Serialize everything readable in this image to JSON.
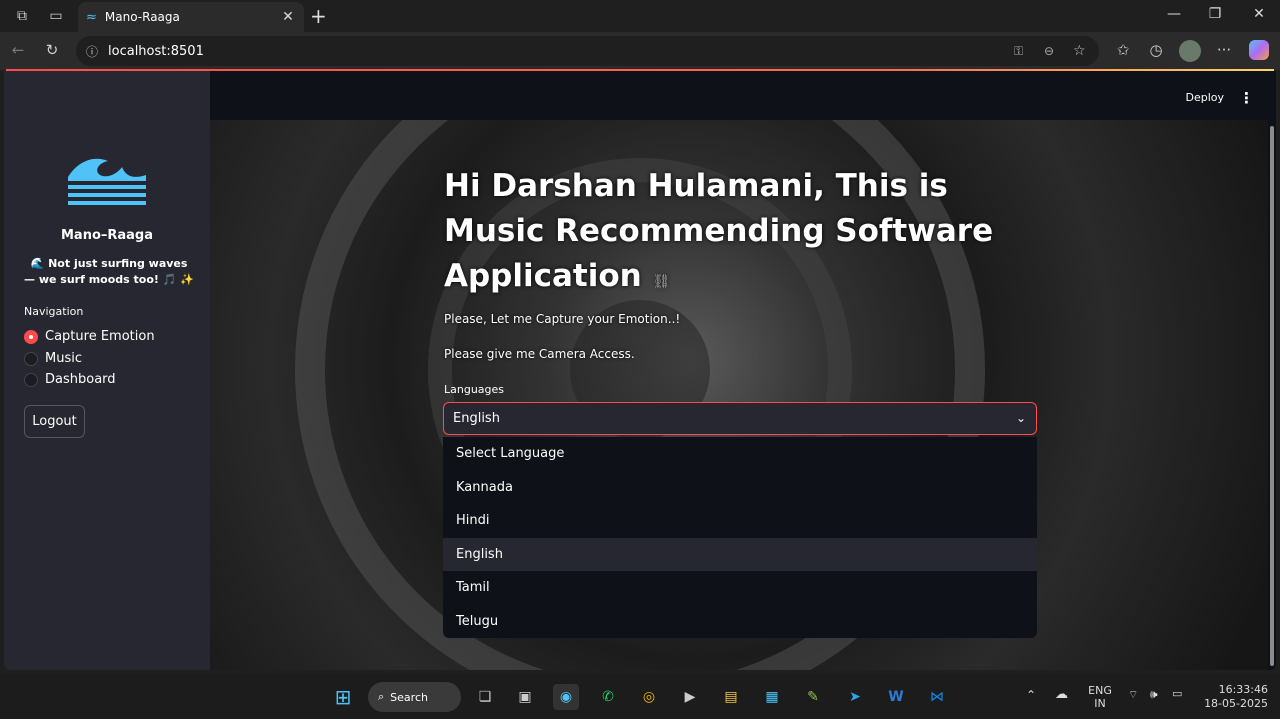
{
  "browser": {
    "tab_title": "Mano-Raaga",
    "url": "localhost:8501"
  },
  "header": {
    "deploy_label": "Deploy"
  },
  "sidebar": {
    "app_name": "Mano–Raaga",
    "tagline": "🌊 Not just surfing waves — we surf moods too! 🎵 ✨",
    "nav_label": "Navigation",
    "nav_items": [
      {
        "label": "Capture Emotion",
        "selected": true
      },
      {
        "label": "Music",
        "selected": false
      },
      {
        "label": "Dashboard",
        "selected": false
      }
    ],
    "logout_label": "Logout"
  },
  "main": {
    "heading": "Hi Darshan Hulamani, This is Music Recommending Software Application",
    "line1": "Please, Let me Capture your Emotion..!",
    "line2": "Please give me Camera Access.",
    "languages_label": "Languages",
    "selected_language": "English",
    "language_options": [
      "Select Language",
      "Kannada",
      "Hindi",
      "English",
      "Tamil",
      "Telugu"
    ]
  },
  "taskbar": {
    "search_label": "Search",
    "lang_top": "ENG",
    "lang_bottom": "IN",
    "time": "16:33:46",
    "date": "18-05-2025"
  },
  "colors": {
    "accent": "#ff4b4b",
    "sidebar_bg": "#262730",
    "app_bg": "#0e1117"
  }
}
